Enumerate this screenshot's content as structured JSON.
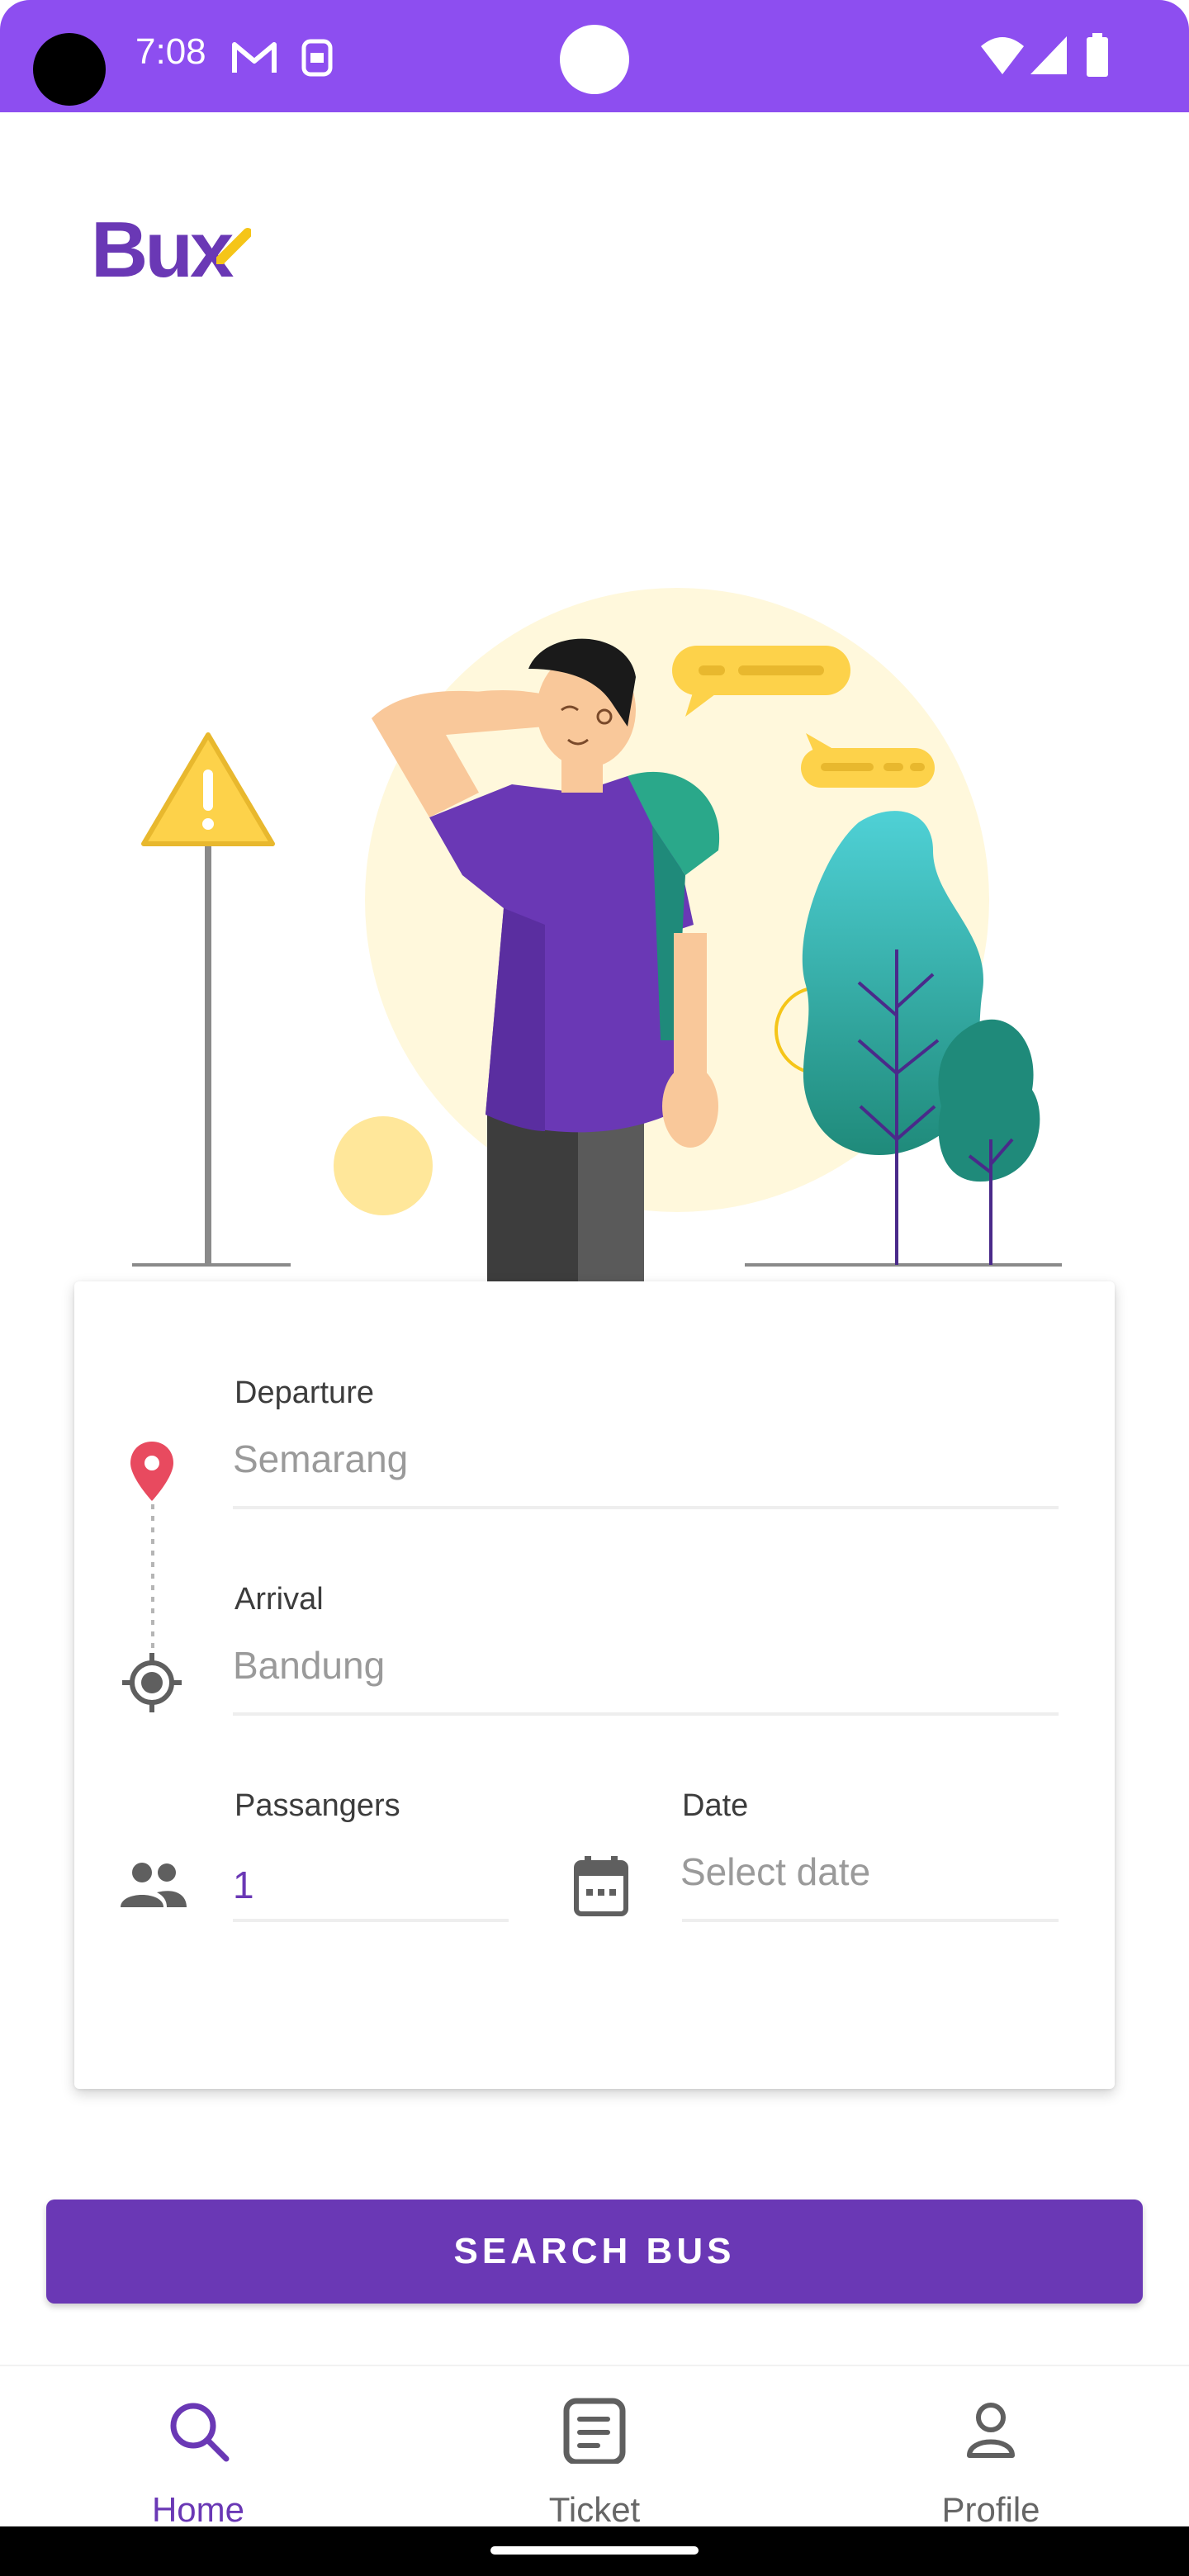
{
  "status_bar": {
    "time": "7:08",
    "icons": [
      "gmail-icon",
      "sim-icon",
      "wifi-icon",
      "signal-icon",
      "battery-icon"
    ]
  },
  "app": {
    "logo_text": "Bux",
    "brand_color": "#6a38b5",
    "status_color": "#8d4ef0"
  },
  "form": {
    "departure": {
      "label": "Departure",
      "value": "Semarang"
    },
    "arrival": {
      "label": "Arrival",
      "value": "Bandung"
    },
    "passengers": {
      "label": "Passangers",
      "value": "1"
    },
    "date": {
      "label": "Date",
      "placeholder": "Select date"
    }
  },
  "search_button": {
    "label": "SEARCH BUS"
  },
  "bottom_nav": {
    "items": [
      {
        "label": "Home",
        "icon": "search-icon",
        "active": true
      },
      {
        "label": "Ticket",
        "icon": "ticket-icon",
        "active": false
      },
      {
        "label": "Profile",
        "icon": "profile-icon",
        "active": false
      }
    ]
  }
}
